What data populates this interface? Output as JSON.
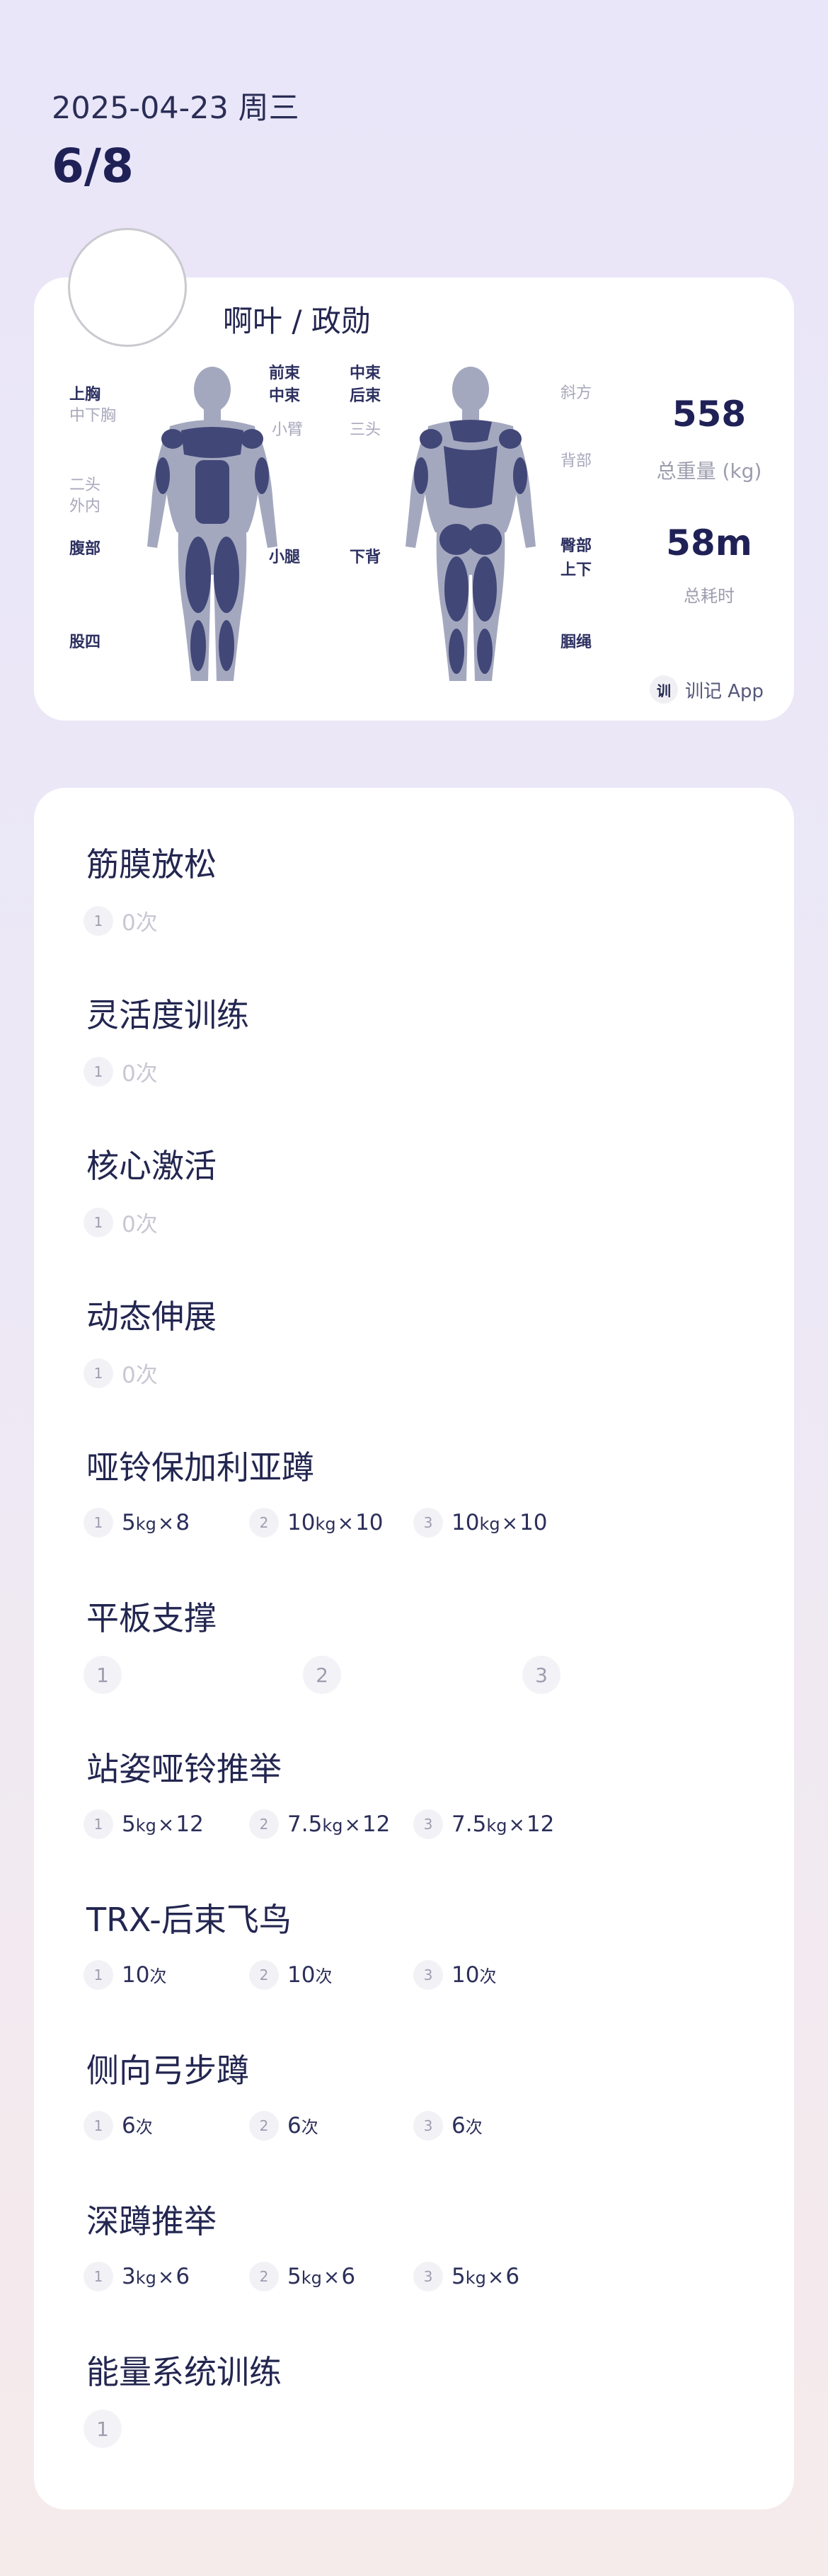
{
  "header": {
    "date": "2025-04-23 周三",
    "progress": "6/8"
  },
  "summary": {
    "user_name": "啊叶 / 政勋",
    "front_labels": {
      "upper_chest": "上胸",
      "middle_lower_chest": "中下胸",
      "front_delt": "前束",
      "middle_delt": "中束",
      "forearm": "小臂",
      "biceps": "二头",
      "outer_inner": "外内",
      "abs": "腹部",
      "lower_leg": "小腿",
      "quads": "股四"
    },
    "back_labels": {
      "middle_delt": "中束",
      "rear_delt": "后束",
      "triceps": "三头",
      "obliques": "斜方",
      "back": "背部",
      "lower_back": "下背",
      "glutes": "臀部",
      "upper_lower": "上下",
      "hamstrings": "腘绳"
    },
    "total_weight_value": "558",
    "total_weight_label": "总重量 (kg)",
    "total_time_value": "58m",
    "total_time_label": "总耗时",
    "brand_icon": "训",
    "brand": "训记 App",
    "colors": {
      "muscle": "#414777",
      "body": "#a4a8bf",
      "accent": "#1f2156"
    }
  },
  "exercises": [
    {
      "title": "筋膜放松",
      "sets": [
        {
          "idx": "1",
          "text": "0次"
        }
      ]
    },
    {
      "title": "灵活度训练",
      "sets": [
        {
          "idx": "1",
          "text": "0次"
        }
      ]
    },
    {
      "title": "核心激活",
      "sets": [
        {
          "idx": "1",
          "text": "0次"
        }
      ]
    },
    {
      "title": "动态伸展",
      "sets": [
        {
          "idx": "1",
          "text": "0次"
        }
      ]
    },
    {
      "title": "哑铃保加利亚蹲",
      "sets": [
        {
          "idx": "1",
          "w": "5",
          "u": "kg",
          "x": "×",
          "r": "8"
        },
        {
          "idx": "2",
          "w": "10",
          "u": "kg",
          "x": "×",
          "r": "10"
        },
        {
          "idx": "3",
          "w": "10",
          "u": "kg",
          "x": "×",
          "r": "10"
        }
      ]
    },
    {
      "title": "平板支撑",
      "sets": [
        {
          "idx": "1"
        },
        {
          "idx": "2"
        },
        {
          "idx": "3"
        }
      ]
    },
    {
      "title": "站姿哑铃推举",
      "sets": [
        {
          "idx": "1",
          "w": "5",
          "u": "kg",
          "x": "×",
          "r": "12"
        },
        {
          "idx": "2",
          "w": "7.5",
          "u": "kg",
          "x": "×",
          "r": "12"
        },
        {
          "idx": "3",
          "w": "7.5",
          "u": "kg",
          "x": "×",
          "r": "12"
        }
      ]
    },
    {
      "title": "TRX-后束飞鸟",
      "sets": [
        {
          "idx": "1",
          "w": "10",
          "u": "次"
        },
        {
          "idx": "2",
          "w": "10",
          "u": "次"
        },
        {
          "idx": "3",
          "w": "10",
          "u": "次"
        }
      ]
    },
    {
      "title": "侧向弓步蹲",
      "sets": [
        {
          "idx": "1",
          "w": "6",
          "u": "次"
        },
        {
          "idx": "2",
          "w": "6",
          "u": "次"
        },
        {
          "idx": "3",
          "w": "6",
          "u": "次"
        }
      ]
    },
    {
      "title": "深蹲推举",
      "sets": [
        {
          "idx": "1",
          "w": "3",
          "u": "kg",
          "x": "×",
          "r": "6"
        },
        {
          "idx": "2",
          "w": "5",
          "u": "kg",
          "x": "×",
          "r": "6"
        },
        {
          "idx": "3",
          "w": "5",
          "u": "kg",
          "x": "×",
          "r": "6"
        }
      ]
    },
    {
      "title": "能量系统训练",
      "sets": [
        {
          "idx": "1"
        }
      ]
    }
  ]
}
